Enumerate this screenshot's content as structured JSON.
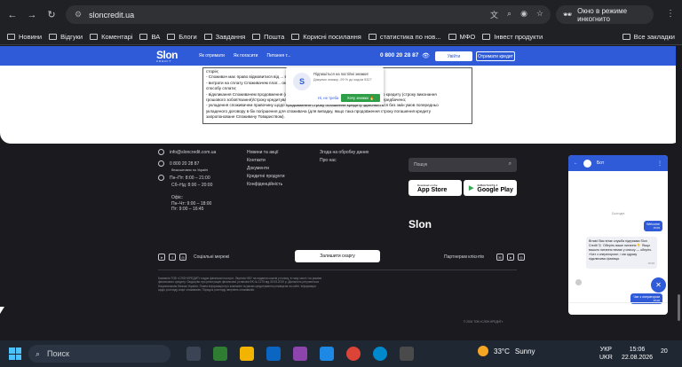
{
  "browser": {
    "url": "sloncredit.ua",
    "incognito_label": "Окно в режиме инкогнито",
    "bookmarks": [
      "Новини",
      "Відгуки",
      "Коментарі",
      "ВА",
      "Блоги",
      "Завдання",
      "Пошта",
      "Корисні посилання",
      "статистика по нов...",
      "МФО",
      "Інвест продукти"
    ],
    "all_bookmarks": "Все закладки"
  },
  "site_nav": {
    "logo": "Slon",
    "logo_sub": "CREDIT",
    "links": [
      "Як отримати",
      "Як погасити",
      "Питання т..."
    ],
    "phone": "0 800 20 28 87",
    "login": "Увійти",
    "apply": "Отримати кредит"
  },
  "terms_text": [
    "сторін;",
    "- Споживач має право відмовитися від ...                                 вибраних каналів комунікації;",
    "- витрати на сплату Споживачем плат...                                   оказ від обраного споживачем",
    "способу сплати;",
    "- відкликання Споживачем продовження (лонгації, пролонгації) строку повернення споживчого кредиту (строку виконання",
    "грошового зобов'язання)/строку кредитування/строку дії договору про споживчий кредит не передбачено;",
    "- укладення споживачем правочину щодо продовження строку погашення кредиту здійснюється без змін умов попередньо",
    "укладеного договору в бік погіршення для споживача (для випадку, якщо така продовження строку погашення кредиту",
    "запропоноване Споживачу Товариством)."
  ],
  "push_popup": {
    "title": "Підпишіться на постійні знижки!",
    "subtitle": "Дякуємо знижку -99 % до кодом 5327",
    "no": "Ні, не треба",
    "yes": "Хочу знижки 🔥"
  },
  "footer": {
    "email": "info@sloncredit.com.ua",
    "phone": "0 800 20 28 87",
    "phone_note": "безкоштовно по Україні",
    "hours1": "Пн–Пт: 8:00 – 21:00",
    "hours2": "Сб–Нд: 8:00 – 20:00",
    "office_label": "Офіс:",
    "office1": "Пн–Чт: 9:00 – 18:00",
    "office2": "Пт: 9:00 – 16:45",
    "links_col1": [
      "Новини та акції",
      "Контакти",
      "Документи",
      "Кредитні продукти",
      "Конфіденційність"
    ],
    "links_col2": [
      "Згода на обробку даних",
      "Про нас"
    ],
    "search_placeholder": "Пошук",
    "app_store_sub": "Download on the",
    "app_store": "App Store",
    "google_play_sub": "ЗАВАНТАЖТЕ З",
    "google_play": "Google Play",
    "slon": "Slon",
    "social_label": "Соціальні мережі",
    "review": "Залишити скаргу",
    "partners": "Партнерам клієнтів",
    "legal": "Компанія ТОВ «СЛОН КРЕДИТ» надає фінансові послуги. Ліцензія НБУ на надання коштів у позику, в тому числі і на умовах фінансового кредиту. Свідоцтво про реєстрацію фінансової установи ФК № 1275 від 30.05.2019 р. Діяльність регулюється Національним банком України. Повна інформація про компанію та умови кредитування розміщена на сайті. Інформація щодо розгляду скарг споживачів. Порядок розгляду звернень споживачів.",
    "copyright": "© 2024 ТОВ «СЛОН КРЕДИТ»"
  },
  "chat": {
    "title": "Бот",
    "date": "Сьогодні",
    "user_msg1": "Welcome",
    "user_time1": "15:06",
    "bot_msg": "Вітаю! Вас вітає служба підтримки Slon Credit 🐘 Оберіть ваше питання 👇 Якщо вашого питання немає у списку — оберіть «Чат з оператором», і ми одразу підключимо фахівця.",
    "bot_time": "15:06",
    "user_msg2": "Чат з оператором",
    "user_time2": "15:06"
  },
  "taskbar": {
    "search": "Поиск",
    "temp": "33°C",
    "weather": "Sunny",
    "lang1": "УКР",
    "lang2": "UKR",
    "time": "15:06",
    "date": "22.08.2026",
    "notifications": "20"
  }
}
